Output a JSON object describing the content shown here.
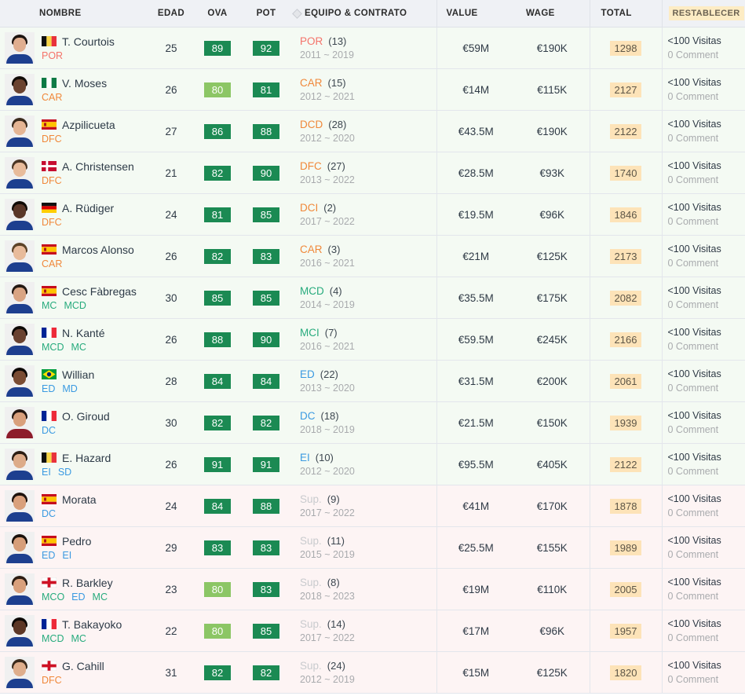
{
  "header": {
    "columns": [
      {
        "key": "nombre",
        "label": "NOMBRE"
      },
      {
        "key": "edad",
        "label": "EDAD"
      },
      {
        "key": "ova",
        "label": "OVA"
      },
      {
        "key": "pot",
        "label": "POT"
      },
      {
        "key": "equipo",
        "label": "EQUIPO & CONTRATO",
        "sort_icon": "sort-diamond-icon"
      },
      {
        "key": "value",
        "label": "VALUE"
      },
      {
        "key": "wage",
        "label": "WAGE"
      },
      {
        "key": "total",
        "label": "TOTAL"
      },
      {
        "key": "reset",
        "label": "RESTABLECER"
      }
    ]
  },
  "colors": {
    "header_bg": "#eff1f5",
    "row_starter_bg": "#f4faf3",
    "row_sub_bg": "#fdf4f4",
    "rating_high": "#1b8a53",
    "rating_low": "#8cc665",
    "total_badge": "#fde3b8",
    "reset_badge": "#fdecc4",
    "pos_goalkeeper": "#f4736a",
    "pos_defender": "#f0883a",
    "pos_midfield": "#27ab7d",
    "pos_attack": "#3b9ae1",
    "pos_sub": "#c9cbce"
  },
  "rows": [
    {
      "row_type": "starter",
      "name": "T. Courtois",
      "nationality": "belgium",
      "flag_colors": [
        "#101010",
        "#f8d548",
        "#e8323c"
      ],
      "photo": {
        "hair": "#1d1410",
        "skin": "#e0ae90",
        "kit": "#1d3f8f"
      },
      "positions": [
        {
          "label": "POR",
          "color_class": "c-por"
        }
      ],
      "edad": "25",
      "ova": "89",
      "ova_class": "r-dark",
      "pot": "92",
      "pot_class": "r-dark",
      "team_pos": "POR",
      "team_pos_class": "c-por",
      "team_num": "(13)",
      "years": "2011 ~ 2019",
      "value": "€59M",
      "wage": "€190K",
      "total": "1298",
      "visits": "<100 Visitas",
      "comments": "0 Comment"
    },
    {
      "row_type": "starter",
      "name": "V. Moses",
      "nationality": "nigeria",
      "flag_colors": [
        "#0e7a45",
        "#ffffff",
        "#0e7a45"
      ],
      "photo": {
        "hair": "#120c08",
        "skin": "#6b4330",
        "kit": "#1d3f8f"
      },
      "positions": [
        {
          "label": "CAR",
          "color_class": "c-def"
        }
      ],
      "edad": "26",
      "ova": "80",
      "ova_class": "r-light",
      "pot": "81",
      "pot_class": "r-dark",
      "team_pos": "CAR",
      "team_pos_class": "c-def",
      "team_num": "(15)",
      "years": "2012 ~ 2021",
      "value": "€14M",
      "wage": "€115K",
      "total": "2127",
      "visits": "<100 Visitas",
      "comments": "0 Comment"
    },
    {
      "row_type": "starter",
      "name": "Azpilicueta",
      "nationality": "spain",
      "flag_colors": [
        "#c60b1e",
        "#ffc400",
        "#c60b1e"
      ],
      "photo": {
        "hair": "#3a2a1c",
        "skin": "#e5b594",
        "kit": "#1d3f8f"
      },
      "positions": [
        {
          "label": "DFC",
          "color_class": "c-def"
        }
      ],
      "edad": "27",
      "ova": "86",
      "ova_class": "r-dark",
      "pot": "88",
      "pot_class": "r-dark",
      "team_pos": "DCD",
      "team_pos_class": "c-def",
      "team_num": "(28)",
      "years": "2012 ~ 2020",
      "value": "€43.5M",
      "wage": "€190K",
      "total": "2122",
      "visits": "<100 Visitas",
      "comments": "0 Comment"
    },
    {
      "row_type": "starter",
      "name": "A. Christensen",
      "nationality": "denmark",
      "flag_colors": [
        "#c60c30",
        "#ffffff",
        "#c60c30"
      ],
      "photo": {
        "hair": "#4a3524",
        "skin": "#e8bb9b",
        "kit": "#1d3f8f"
      },
      "positions": [
        {
          "label": "DFC",
          "color_class": "c-def"
        }
      ],
      "edad": "21",
      "ova": "82",
      "ova_class": "r-dark",
      "pot": "90",
      "pot_class": "r-dark",
      "team_pos": "DFC",
      "team_pos_class": "c-def",
      "team_num": "(27)",
      "years": "2013 ~ 2022",
      "value": "€28.5M",
      "wage": "€93K",
      "total": "1740",
      "visits": "<100 Visitas",
      "comments": "0 Comment"
    },
    {
      "row_type": "starter",
      "name": "A. Rüdiger",
      "nationality": "germany",
      "flag_colors": [
        "#111111",
        "#dd0000",
        "#ffce00"
      ],
      "photo": {
        "hair": "#100a06",
        "skin": "#5a3628",
        "kit": "#1d3f8f"
      },
      "positions": [
        {
          "label": "DFC",
          "color_class": "c-def"
        }
      ],
      "edad": "24",
      "ova": "81",
      "ova_class": "r-dark",
      "pot": "85",
      "pot_class": "r-dark",
      "team_pos": "DCI",
      "team_pos_class": "c-def",
      "team_num": "(2)",
      "years": "2017 ~ 2022",
      "value": "€19.5M",
      "wage": "€96K",
      "total": "1846",
      "visits": "<100 Visitas",
      "comments": "0 Comment"
    },
    {
      "row_type": "starter",
      "name": "Marcos Alonso",
      "nationality": "spain",
      "flag_colors": [
        "#c60b1e",
        "#ffc400",
        "#c60b1e"
      ],
      "photo": {
        "hair": "#5c4328",
        "skin": "#e8bb9b",
        "kit": "#1d3f8f"
      },
      "positions": [
        {
          "label": "CAR",
          "color_class": "c-def"
        }
      ],
      "edad": "26",
      "ova": "82",
      "ova_class": "r-dark",
      "pot": "83",
      "pot_class": "r-dark",
      "team_pos": "CAR",
      "team_pos_class": "c-def",
      "team_num": "(3)",
      "years": "2016 ~ 2021",
      "value": "€21M",
      "wage": "€125K",
      "total": "2173",
      "visits": "<100 Visitas",
      "comments": "0 Comment"
    },
    {
      "row_type": "starter",
      "name": "Cesc Fàbregas",
      "nationality": "spain",
      "flag_colors": [
        "#c60b1e",
        "#ffc400",
        "#c60b1e"
      ],
      "photo": {
        "hair": "#231812",
        "skin": "#d9a483",
        "kit": "#1d3f8f"
      },
      "positions": [
        {
          "label": "MC",
          "color_class": "c-mid"
        },
        {
          "label": "MCD",
          "color_class": "c-mid"
        }
      ],
      "edad": "30",
      "ova": "85",
      "ova_class": "r-dark",
      "pot": "85",
      "pot_class": "r-dark",
      "team_pos": "MCD",
      "team_pos_class": "c-mid",
      "team_num": "(4)",
      "years": "2014 ~ 2019",
      "value": "€35.5M",
      "wage": "€175K",
      "total": "2082",
      "visits": "<100 Visitas",
      "comments": "0 Comment"
    },
    {
      "row_type": "starter",
      "name": "N. Kanté",
      "nationality": "france",
      "flag_colors": [
        "#002395",
        "#ffffff",
        "#ed2939"
      ],
      "photo": {
        "hair": "#0d0906",
        "skin": "#6a4231",
        "kit": "#1d3f8f"
      },
      "positions": [
        {
          "label": "MCD",
          "color_class": "c-mid"
        },
        {
          "label": "MC",
          "color_class": "c-mid"
        }
      ],
      "edad": "26",
      "ova": "88",
      "ova_class": "r-dark",
      "pot": "90",
      "pot_class": "r-dark",
      "team_pos": "MCI",
      "team_pos_class": "c-mid",
      "team_num": "(7)",
      "years": "2016 ~ 2021",
      "value": "€59.5M",
      "wage": "€245K",
      "total": "2166",
      "visits": "<100 Visitas",
      "comments": "0 Comment"
    },
    {
      "row_type": "starter",
      "name": "Willian",
      "nationality": "brazil",
      "flag_colors": [
        "#009c3b",
        "#ffdf00",
        "#002776"
      ],
      "photo": {
        "hair": "#0c0805",
        "skin": "#7a4c33",
        "kit": "#1d3f8f"
      },
      "positions": [
        {
          "label": "ED",
          "color_class": "c-att"
        },
        {
          "label": "MD",
          "color_class": "c-att"
        }
      ],
      "edad": "28",
      "ova": "84",
      "ova_class": "r-dark",
      "pot": "84",
      "pot_class": "r-dark",
      "team_pos": "ED",
      "team_pos_class": "c-att",
      "team_num": "(22)",
      "years": "2013 ~ 2020",
      "value": "€31.5M",
      "wage": "€200K",
      "total": "2061",
      "visits": "<100 Visitas",
      "comments": "0 Comment"
    },
    {
      "row_type": "starter",
      "name": "O. Giroud",
      "nationality": "france",
      "flag_colors": [
        "#002395",
        "#ffffff",
        "#ed2939"
      ],
      "photo": {
        "hair": "#241711",
        "skin": "#d9a07c",
        "kit": "#8d1c2b"
      },
      "positions": [
        {
          "label": "DC",
          "color_class": "c-att"
        }
      ],
      "edad": "30",
      "ova": "82",
      "ova_class": "r-dark",
      "pot": "82",
      "pot_class": "r-dark",
      "team_pos": "DC",
      "team_pos_class": "c-att",
      "team_num": "(18)",
      "years": "2018 ~ 2019",
      "value": "€21.5M",
      "wage": "€150K",
      "total": "1939",
      "visits": "<100 Visitas",
      "comments": "0 Comment"
    },
    {
      "row_type": "starter",
      "name": "E. Hazard",
      "nationality": "belgium",
      "flag_colors": [
        "#101010",
        "#f8d548",
        "#e8323c"
      ],
      "photo": {
        "hair": "#2a1c12",
        "skin": "#ddab89",
        "kit": "#1d3f8f"
      },
      "positions": [
        {
          "label": "EI",
          "color_class": "c-att"
        },
        {
          "label": "SD",
          "color_class": "c-att"
        }
      ],
      "edad": "26",
      "ova": "91",
      "ova_class": "r-dark",
      "pot": "91",
      "pot_class": "r-dark",
      "team_pos": "EI",
      "team_pos_class": "c-att",
      "team_num": "(10)",
      "years": "2012 ~ 2020",
      "value": "€95.5M",
      "wage": "€405K",
      "total": "2122",
      "visits": "<100 Visitas",
      "comments": "0 Comment"
    },
    {
      "row_type": "sub",
      "name": "Morata",
      "nationality": "spain",
      "flag_colors": [
        "#c60b1e",
        "#ffc400",
        "#c60b1e"
      ],
      "photo": {
        "hair": "#1d130d",
        "skin": "#d9a07c",
        "kit": "#1d3f8f"
      },
      "positions": [
        {
          "label": "DC",
          "color_class": "c-att"
        }
      ],
      "edad": "24",
      "ova": "84",
      "ova_class": "r-dark",
      "pot": "88",
      "pot_class": "r-dark",
      "team_pos": "Sup.",
      "team_pos_class": "c-sup",
      "team_num": "(9)",
      "years": "2017 ~ 2022",
      "value": "€41M",
      "wage": "€170K",
      "total": "1878",
      "visits": "<100 Visitas",
      "comments": "0 Comment"
    },
    {
      "row_type": "sub",
      "name": "Pedro",
      "nationality": "spain",
      "flag_colors": [
        "#c60b1e",
        "#ffc400",
        "#c60b1e"
      ],
      "photo": {
        "hair": "#1a110b",
        "skin": "#d79e79",
        "kit": "#1d3f8f"
      },
      "positions": [
        {
          "label": "ED",
          "color_class": "c-att"
        },
        {
          "label": "EI",
          "color_class": "c-att"
        }
      ],
      "edad": "29",
      "ova": "83",
      "ova_class": "r-dark",
      "pot": "83",
      "pot_class": "r-dark",
      "team_pos": "Sup.",
      "team_pos_class": "c-sup",
      "team_num": "(11)",
      "years": "2015 ~ 2019",
      "value": "€25.5M",
      "wage": "€155K",
      "total": "1989",
      "visits": "<100 Visitas",
      "comments": "0 Comment"
    },
    {
      "row_type": "sub",
      "name": "R. Barkley",
      "nationality": "england",
      "flag_colors": [
        "#ffffff",
        "#ce1124",
        "#ffffff"
      ],
      "photo": {
        "hair": "#2c1d13",
        "skin": "#d9a07c",
        "kit": "#1d3f8f"
      },
      "positions": [
        {
          "label": "MCO",
          "color_class": "c-mid"
        },
        {
          "label": "ED",
          "color_class": "c-att"
        },
        {
          "label": "MC",
          "color_class": "c-mid"
        }
      ],
      "edad": "23",
      "ova": "80",
      "ova_class": "r-light",
      "pot": "83",
      "pot_class": "r-dark",
      "team_pos": "Sup.",
      "team_pos_class": "c-sup",
      "team_num": "(8)",
      "years": "2018 ~ 2023",
      "value": "€19M",
      "wage": "€110K",
      "total": "2005",
      "visits": "<100 Visitas",
      "comments": "0 Comment"
    },
    {
      "row_type": "sub",
      "name": "T. Bakayoko",
      "nationality": "france",
      "flag_colors": [
        "#002395",
        "#ffffff",
        "#ed2939"
      ],
      "photo": {
        "hair": "#0c0805",
        "skin": "#5d3726",
        "kit": "#1d3f8f"
      },
      "positions": [
        {
          "label": "MCD",
          "color_class": "c-mid"
        },
        {
          "label": "MC",
          "color_class": "c-mid"
        }
      ],
      "edad": "22",
      "ova": "80",
      "ova_class": "r-light",
      "pot": "85",
      "pot_class": "r-dark",
      "team_pos": "Sup.",
      "team_pos_class": "c-sup",
      "team_num": "(14)",
      "years": "2017 ~ 2022",
      "value": "€17M",
      "wage": "€96K",
      "total": "1957",
      "visits": "<100 Visitas",
      "comments": "0 Comment"
    },
    {
      "row_type": "sub",
      "name": "G. Cahill",
      "nationality": "england",
      "flag_colors": [
        "#ffffff",
        "#ce1124",
        "#ffffff"
      ],
      "photo": {
        "hair": "#3a2a1c",
        "skin": "#dfae8c",
        "kit": "#1d3f8f"
      },
      "positions": [
        {
          "label": "DFC",
          "color_class": "c-def"
        }
      ],
      "edad": "31",
      "ova": "82",
      "ova_class": "r-dark",
      "pot": "82",
      "pot_class": "r-dark",
      "team_pos": "Sup.",
      "team_pos_class": "c-sup",
      "team_num": "(24)",
      "years": "2012 ~ 2019",
      "value": "€15M",
      "wage": "€125K",
      "total": "1820",
      "visits": "<100 Visitas",
      "comments": "0 Comment"
    }
  ]
}
